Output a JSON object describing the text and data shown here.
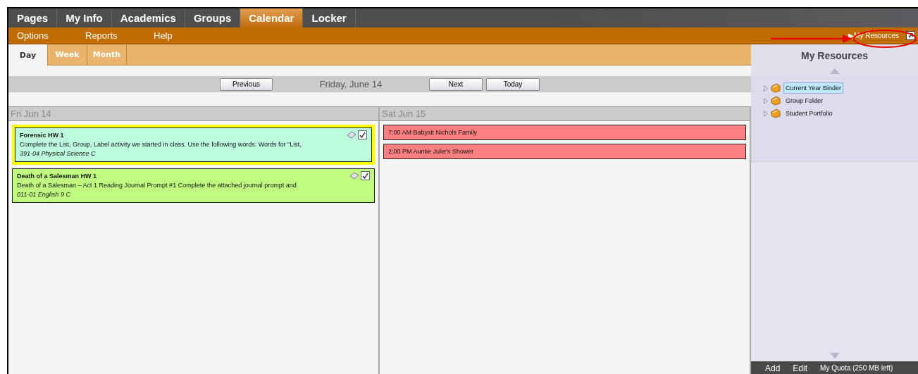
{
  "nav_tabs": [
    {
      "label": "Pages",
      "selected": false
    },
    {
      "label": "My Info",
      "selected": false
    },
    {
      "label": "Academics",
      "selected": false
    },
    {
      "label": "Groups",
      "selected": false
    },
    {
      "label": "Calendar",
      "selected": true
    },
    {
      "label": "Locker",
      "selected": false
    }
  ],
  "menu": [
    "Options",
    "Reports",
    "Help"
  ],
  "resources_link": {
    "arrow": "▶",
    "label": "My Resources"
  },
  "view_tabs": [
    {
      "label": "Day",
      "selected": true
    },
    {
      "label": "Week",
      "selected": false
    },
    {
      "label": "Month",
      "selected": false
    }
  ],
  "date_nav": {
    "previous": "Previous",
    "date": "Friday, June 14",
    "next": "Next",
    "today": "Today"
  },
  "days": [
    {
      "heading": "Fri Jun 14",
      "items": [
        {
          "kind": "assignment",
          "title": "Forensic HW 1",
          "text": "Complete the List, Group, Label activity we started in class. Use the following words:   Words for \"List,",
          "course": "391-04 Physical Science C",
          "color": "#bdfcdc",
          "selected": true,
          "checked": true
        },
        {
          "kind": "assignment",
          "title": "Death of a  Salesman HW 1",
          "text": "Death of a Salesman – Act 1 Reading Journal Prompt #1 Complete the attached journal prompt and",
          "course": "011-01 English 9 C",
          "color": "#c0fc80",
          "selected": false,
          "checked": true
        }
      ]
    },
    {
      "heading": "Sat Jun 15",
      "items": [
        {
          "kind": "event",
          "text": "7:00 AM Babysit Nichols Family",
          "color": "#ff8080"
        },
        {
          "kind": "event",
          "text": "2:00 PM Auntie Julie's Shower",
          "color": "#ff8080"
        }
      ]
    }
  ],
  "resources": {
    "title": "My Resources",
    "tree": [
      {
        "label": "Current Year Binder",
        "selected": true,
        "expanded": false
      },
      {
        "label": "Group Folder",
        "selected": false,
        "expanded": false
      },
      {
        "label": "Student Portfolio",
        "selected": false,
        "expanded": false
      }
    ],
    "footer": {
      "add": "Add",
      "edit": "Edit",
      "quota": "My Quota (250 MB left)"
    }
  }
}
